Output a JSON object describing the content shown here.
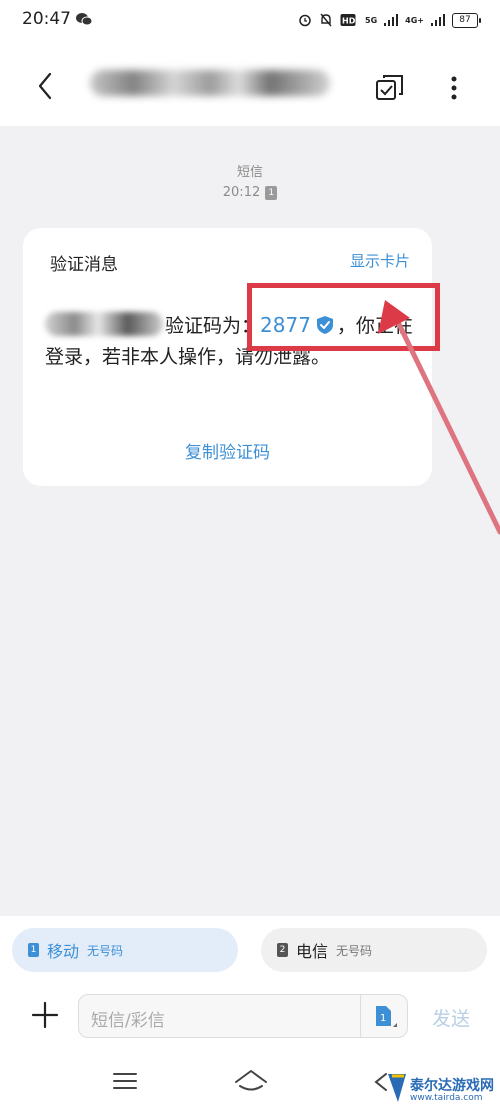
{
  "status_bar": {
    "time": "20:47",
    "network1": "5G",
    "network2": "4G+",
    "battery": "87"
  },
  "header": {
    "contact_name": ""
  },
  "thread": {
    "channel_label": "短信",
    "time": "20:12",
    "sim_slot": "1"
  },
  "message_card": {
    "title": "验证消息",
    "show_card_label": "显示卡片",
    "text_before_code": "验证码为：",
    "code": "2877",
    "text_after_code": "，你正在登录，若非本人操作，请勿泄露。",
    "copy_code_label": "复制验证码"
  },
  "sim_selector": {
    "sim1": {
      "slot": "1",
      "carrier": "移动",
      "number": "无号码",
      "selected": true
    },
    "sim2": {
      "slot": "2",
      "carrier": "电信",
      "number": "无号码",
      "selected": false
    }
  },
  "compose": {
    "placeholder": "短信/彩信",
    "send_label": "发送",
    "sim_slot": "1"
  },
  "watermark": {
    "name": "泰尔达游戏网",
    "url": "www.tairda.com"
  },
  "colors": {
    "accent": "#3d8fd6",
    "annotation": "#dd3a48"
  }
}
